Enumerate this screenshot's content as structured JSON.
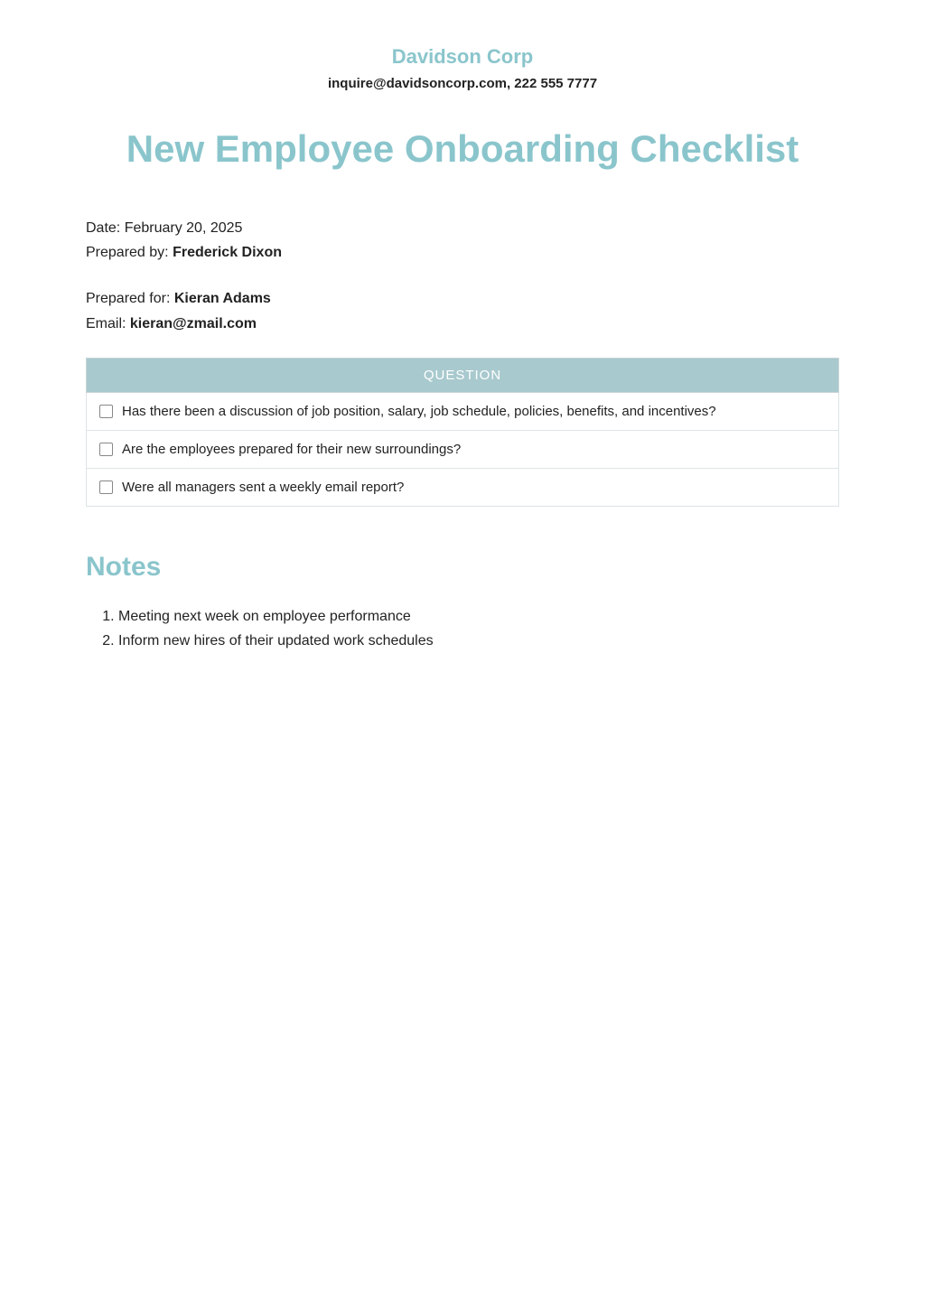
{
  "header": {
    "company_name": "Davidson Corp",
    "contact": "inquire@davidsoncorp.com, 222 555 7777"
  },
  "main_title": "New Employee Onboarding Checklist",
  "meta": {
    "date_label": "Date: ",
    "date_value": "February 20, 2025",
    "prepared_by_label": "Prepared by: ",
    "prepared_by_value": "Frederick Dixon",
    "prepared_for_label": "Prepared for: ",
    "prepared_for_value": "Kieran Adams",
    "email_label": "Email: ",
    "email_value": "kieran@zmail.com"
  },
  "table": {
    "header": "QUESTION",
    "rows": [
      "Has there been a discussion of job position, salary, job schedule, policies, benefits, and incentives?",
      "Are the employees prepared for their new surroundings?",
      "Were all managers sent a weekly email report?"
    ]
  },
  "notes": {
    "heading": "Notes",
    "items": [
      "Meeting next week on employee performance",
      "Inform new hires of their updated work schedules"
    ]
  }
}
